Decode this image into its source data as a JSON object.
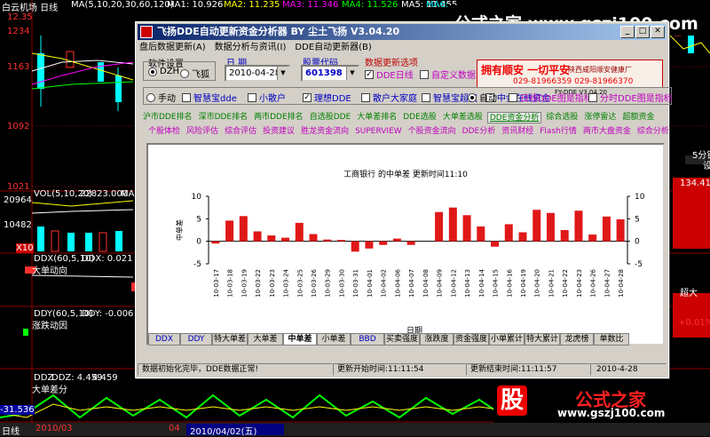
{
  "background": {
    "kline_label": "白云机场 日线",
    "ma_text": "MA(5,10,20,30,60,120)",
    "ma1": "MA1: 10.926",
    "ma2": "MA2: 11.235",
    "ma3": "MA3: 11.346",
    "ma4": "MA4: 11.526",
    "ma5": "MA5: 11.455",
    "ma_tail": "MA6:",
    "price_top_left": "12.35",
    "y_labels": [
      "1163",
      "1092",
      "1021"
    ],
    "y_label_1234": "1234",
    "vol_label": "VOL(5,10,20)",
    "vol_value": "22823.000",
    "vol_tail": "MA1:",
    "vol_side_labels": [
      "20964",
      "10482",
      "X10"
    ],
    "ddx_label": "大单动向",
    "ddx_text": "DDX(60,5,10)",
    "ddx_value": "DDX: 0.021",
    "ddy_label": "涨跌动因",
    "ddy_text": "DDY(60,5,10)",
    "ddy_value": "DDY: -0.006",
    "ddz_label": "大单差分",
    "ddz_text": "DDZ",
    "ddz_value": "DDZ: 4.459",
    "ddz_value2": "4.459",
    "neg_value": "-31.536",
    "bottom_bar_left": "日线",
    "bottom_date1": "2010/03",
    "bottom_date2": "2010/04/02(五)",
    "bottom_04": "04",
    "right_labels": [
      "134.41",
      "超大",
      "+0.01%",
      "5分钟",
      "设"
    ]
  },
  "window": {
    "title": "飞扬DDE自动更新资金分析器  BY 尘土飞扬 V3.04.20",
    "menu": [
      "盘后数据更新(A)",
      "数据分析与资讯(I)",
      "DDE自动更新器(B)"
    ],
    "software_settings_label": "软件设置",
    "radio_dzh": "DZH",
    "radio_feihu": "飞狐",
    "date_label": "日  期",
    "date_value": "2010-04-28",
    "stock_label": "股票代码",
    "stock_value": "601398",
    "update_opts_label": "数据更新选项",
    "chk_dde_daily": "DDE日线",
    "chk_custom": "自定义数据",
    "banner_line1": "拥有顺安  一切平安",
    "banner_line1b": "陕西咸阳顺安健康厂",
    "banner_line2": "029-81966359  029-81966370",
    "banner_sub": "FY-DDE V3.04.20",
    "options": [
      {
        "label": "手动",
        "type": "radio",
        "on": false
      },
      {
        "label": "智慧宝dde",
        "type": "check",
        "on": false
      },
      {
        "label": "小散户",
        "type": "check",
        "on": false
      },
      {
        "label": "理想DDE",
        "type": "check",
        "on": true
      },
      {
        "label": "散户大家庭",
        "type": "check",
        "on": false
      },
      {
        "label": "智慧宝超赢",
        "type": "check",
        "on": false
      },
      {
        "label": "中金在线资金",
        "type": "check",
        "on": false
      },
      {
        "label": "自动",
        "type": "radio",
        "on": true
      },
      {
        "label": "日线DDE图是指标",
        "type": "check",
        "on": false
      },
      {
        "label": "分时DDE图是指标",
        "type": "check",
        "on": false
      }
    ],
    "tabs_row1": [
      "沪市DDE排名",
      "深市DDE排名",
      "两市DDE排名",
      "自选股DDE",
      "大单差排名",
      "DDE选股",
      "大单差选股",
      "DDE资金分析",
      "综合选股",
      "涨停雷达",
      "超额资金"
    ],
    "tabs_row1_active": 7,
    "tabs_row2": [
      "个股体检",
      "风险评估",
      "综合评估",
      "投资建议",
      "胜龙资金流向",
      "SUPERVIEW",
      "个股资金流向",
      "DDE分析",
      "资讯财经",
      "Flash行情",
      "两市大盘资金",
      "综合分析"
    ],
    "bottom_tabs": [
      "DDX",
      "DDY",
      "特大单差",
      "大单差",
      "中单差",
      "小单差",
      "BBD",
      "买卖强度",
      "涨跌度",
      "资金强度",
      "小单累计",
      "特大累计",
      "龙虎榜",
      "单数比"
    ],
    "bottom_tabs_active": 4,
    "status": [
      "数据初始化完毕，DDE数据正常!",
      "更新开始时间:11:11:54",
      "更新结束时间:11:11:57",
      "2010-4-28"
    ]
  },
  "chart_data": {
    "type": "bar",
    "title": "工商银行 的中单差  更新时间11:10",
    "xlabel": "日期",
    "ylabel": "中单差",
    "ylim": [
      -5,
      10
    ],
    "yticks": [
      -5,
      0,
      5,
      10
    ],
    "categories": [
      "10-03-17",
      "10-03-18",
      "10-03-19",
      "10-03-22",
      "10-03-23",
      "10-03-24",
      "10-03-25",
      "10-03-26",
      "10-03-29",
      "10-03-30",
      "10-03-31",
      "10-04-01",
      "10-04-02",
      "10-04-06",
      "10-04-07",
      "10-04-08",
      "10-04-09",
      "10-04-12",
      "10-04-13",
      "10-04-14",
      "10-04-15",
      "10-04-16",
      "10-04-19",
      "10-04-20",
      "10-04-21",
      "10-04-22",
      "10-04-23",
      "10-04-26",
      "10-04-27",
      "10-04-28"
    ],
    "values": [
      -0.5,
      4.6,
      5.6,
      2.2,
      1.3,
      0.8,
      4.1,
      1.6,
      0.4,
      0.3,
      -2.3,
      -1.6,
      -0.8,
      0.6,
      -0.8,
      0,
      6.5,
      7.5,
      5.8,
      3.3,
      -1.2,
      3.8,
      2.0,
      7.0,
      6.3,
      2.5,
      6.8,
      1.5,
      5.5,
      4.9,
      1.2
    ]
  },
  "watermark": {
    "top": "公式之家 www.gszj100.com",
    "bottom_icon": "股",
    "bottom": "公式之家",
    "bottom_url": "www.gszj100.com"
  },
  "colors": {
    "bar": "#e01818",
    "titlebar": "#0a246a",
    "link_tab": "#c000c0",
    "green_tab": "#008000"
  }
}
